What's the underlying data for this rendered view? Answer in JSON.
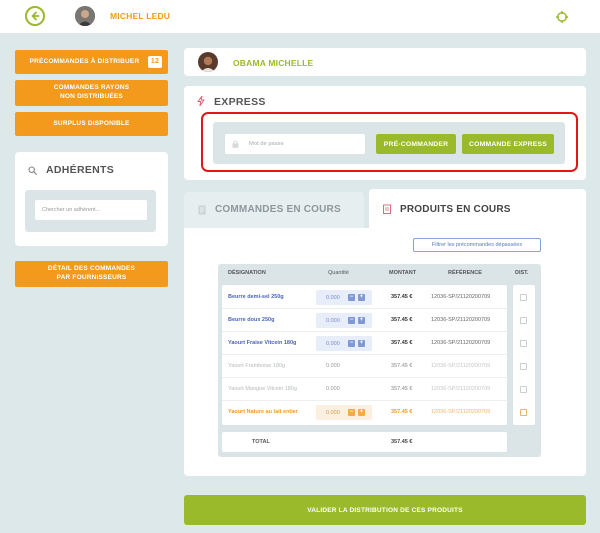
{
  "header": {
    "user_name": "MICHEL LEDU"
  },
  "sidebar": {
    "preorders_label": "PRÉCOMMANDES À DISTRIBUER",
    "preorders_count": "12",
    "shelf_orders_line1": "COMMANDES RAYONS",
    "shelf_orders_line2": "NON DISTRIBUÉES",
    "surplus_label": "SURPLUS DISPONIBLE",
    "members_title": "ADHÉRENTS",
    "member_search_placeholder": "Chercher un adhérent...",
    "supplier_orders_line1": "DÉTAIL DES COMMANDES",
    "supplier_orders_line2": "PAR FOURNISSEURS"
  },
  "member": {
    "name": "OBAMA MICHELLE"
  },
  "express": {
    "title": "EXPRESS",
    "password_placeholder": "Mot de passe",
    "preorder_label": "PRÉ-COMMANDER",
    "express_order_label": "COMMANDE EXPRESS"
  },
  "tabs": {
    "orders_in_progress": "COMMANDES EN COURS",
    "products_in_progress": "PRODUITS EN COURS"
  },
  "filter_label": "Filtrer les précommandes dépassées",
  "table": {
    "headers": {
      "designation": "DÉSIGNATION",
      "quantity": "Quantité",
      "amount": "MONTANT",
      "reference": "RÉFÉRENCE",
      "dist": "DIST."
    },
    "rows": [
      {
        "name": "Beurre demi-sel 250g",
        "qty": "0.000",
        "amount": "357.45 €",
        "ref": "12036-SP/21120200709"
      },
      {
        "name": "Beurre doux 250g",
        "qty": "0.000",
        "amount": "357.45 €",
        "ref": "12036-SP/21120200709"
      },
      {
        "name": "Yaourt Fraise Vitcein 180g",
        "qty": "0.000",
        "amount": "357.45 €",
        "ref": "12036-SP/21120200709"
      },
      {
        "name": "Yaourt Framboise 180g",
        "qty": "0.000",
        "amount": "357.45 €",
        "ref": "12036-SP/21120200709"
      },
      {
        "name": "Yaourt Mangue Vitcein 180g",
        "qty": "0.000",
        "amount": "357.45 €",
        "ref": "12036-SP/21120200709"
      },
      {
        "name": "Yaourt Nature au lait entier",
        "qty": "0.000",
        "amount": "357.45 €",
        "ref": "12036-SP/21120200709"
      }
    ],
    "total_label": "TOTAL",
    "total_amount": "357.45 €"
  },
  "validate_label": "VALIDER LA DISTRIBUTION DE CES PRODUITS",
  "colors": {
    "accent_green": "#9aba2c",
    "accent_orange": "#f39a1d",
    "link_blue": "#4a64b8",
    "highlight_red": "#e01818"
  }
}
